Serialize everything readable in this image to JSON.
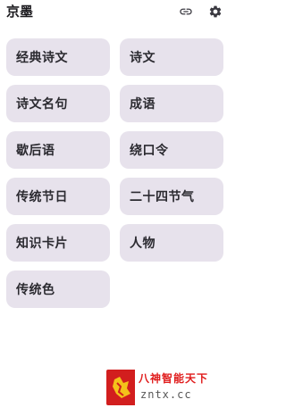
{
  "app_bar": {
    "title": "京墨",
    "link_icon": "link-icon",
    "settings_icon": "gear-icon"
  },
  "menu": {
    "items": [
      {
        "label": "经典诗文"
      },
      {
        "label": "诗文"
      },
      {
        "label": "诗文名句"
      },
      {
        "label": "成语"
      },
      {
        "label": "歇后语"
      },
      {
        "label": "绕口令"
      },
      {
        "label": "传统节日"
      },
      {
        "label": "二十四节气"
      },
      {
        "label": "知识卡片"
      },
      {
        "label": "人物"
      },
      {
        "label": "传统色"
      }
    ]
  },
  "watermark": {
    "text": "八神智能天下",
    "url": "zntx.cc"
  },
  "colors": {
    "tile_background": "#e7e2ec",
    "page_background": "#ffffff",
    "watermark_red": "#d21e1e"
  }
}
